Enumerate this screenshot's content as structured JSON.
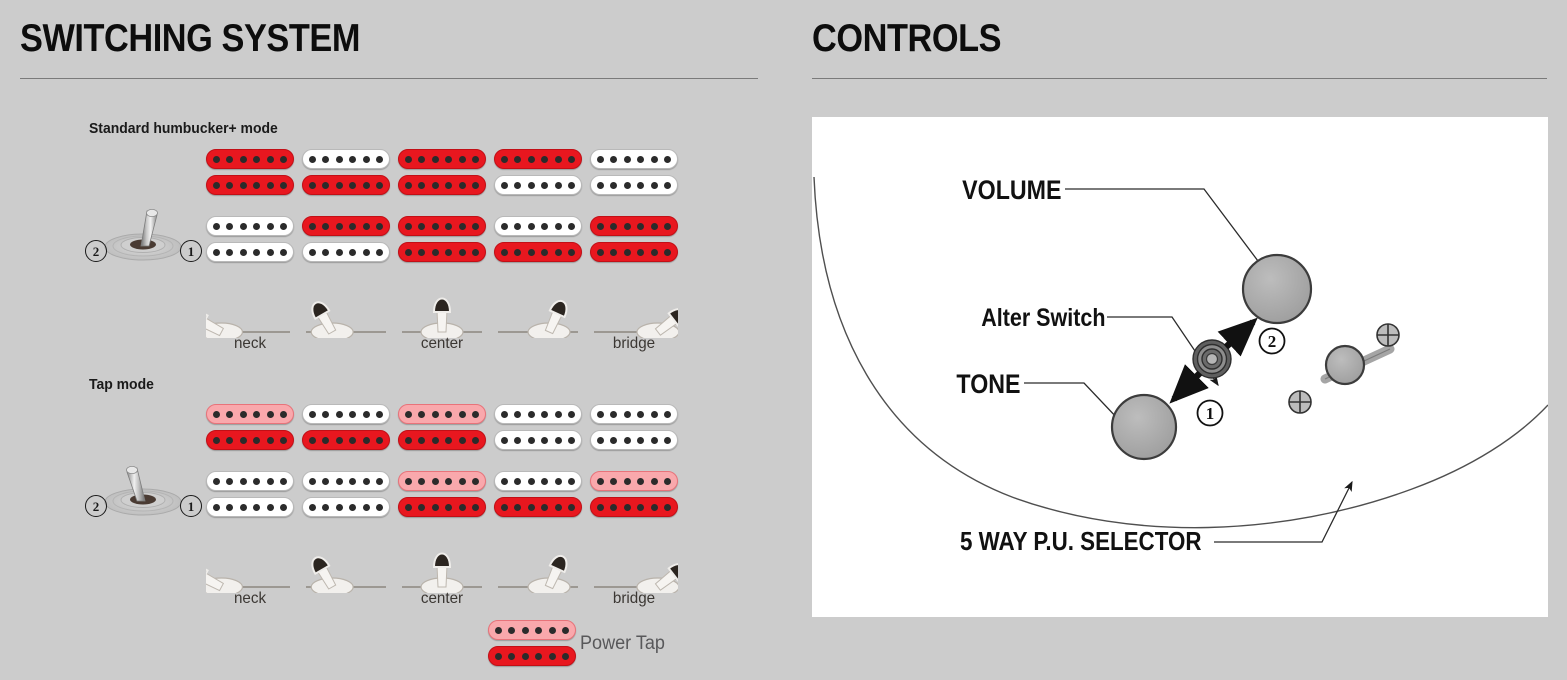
{
  "sections": {
    "switching": {
      "title": "SWITCHING SYSTEM",
      "modes": [
        {
          "label": "Standard humbucker+ mode",
          "switch_position": "1",
          "switch_badges": {
            "left": "2",
            "right": "1"
          },
          "positions": [
            {
              "label": "neck",
              "neck_pickup": [
                "red",
                "red"
              ],
              "bridge_pickup": [
                "white",
                "white"
              ]
            },
            {
              "label": "",
              "neck_pickup": [
                "white",
                "red"
              ],
              "bridge_pickup": [
                "red",
                "white"
              ]
            },
            {
              "label": "center",
              "neck_pickup": [
                "red",
                "red"
              ],
              "bridge_pickup": [
                "red",
                "red"
              ]
            },
            {
              "label": "",
              "neck_pickup": [
                "red",
                "white"
              ],
              "bridge_pickup": [
                "white",
                "red"
              ]
            },
            {
              "label": "bridge",
              "neck_pickup": [
                "white",
                "white"
              ],
              "bridge_pickup": [
                "red",
                "red"
              ]
            }
          ]
        },
        {
          "label": "Tap mode",
          "switch_position": "2",
          "switch_badges": {
            "left": "2",
            "right": "1"
          },
          "positions": [
            {
              "label": "neck",
              "neck_pickup": [
                "pink",
                "red"
              ],
              "bridge_pickup": [
                "white",
                "white"
              ]
            },
            {
              "label": "",
              "neck_pickup": [
                "white",
                "red"
              ],
              "bridge_pickup": [
                "white",
                "white"
              ]
            },
            {
              "label": "center",
              "neck_pickup": [
                "pink",
                "red"
              ],
              "bridge_pickup": [
                "pink",
                "red"
              ]
            },
            {
              "label": "",
              "neck_pickup": [
                "white",
                "white"
              ],
              "bridge_pickup": [
                "white",
                "red"
              ]
            },
            {
              "label": "bridge",
              "neck_pickup": [
                "white",
                "white"
              ],
              "bridge_pickup": [
                "pink",
                "red"
              ]
            }
          ]
        }
      ],
      "legend": {
        "label": "Power Tap",
        "coils": [
          "pink",
          "red"
        ]
      }
    },
    "controls": {
      "title": "CONTROLS",
      "labels": [
        {
          "name": "volume-label",
          "text": "VOLUME"
        },
        {
          "name": "alter-switch-label",
          "text": "Alter Switch"
        },
        {
          "name": "tone-label",
          "text": "TONE"
        },
        {
          "name": "selector-label",
          "text": "5 WAY P.U. SELECTOR"
        }
      ],
      "alter_switch_positions": [
        {
          "badge": "2",
          "direction": "up-right"
        },
        {
          "badge": "1",
          "direction": "down-left"
        }
      ]
    }
  },
  "colors": {
    "background": "#cccccc",
    "panel": "#ffffff",
    "red": "#e8171f",
    "pink": "#f9a8ac",
    "white_coil": "#ffffff",
    "pole": "#2b2b2b",
    "knob": "#a8a8a8",
    "rule": "#7a7a7a",
    "heading": "#0d0d0d"
  }
}
